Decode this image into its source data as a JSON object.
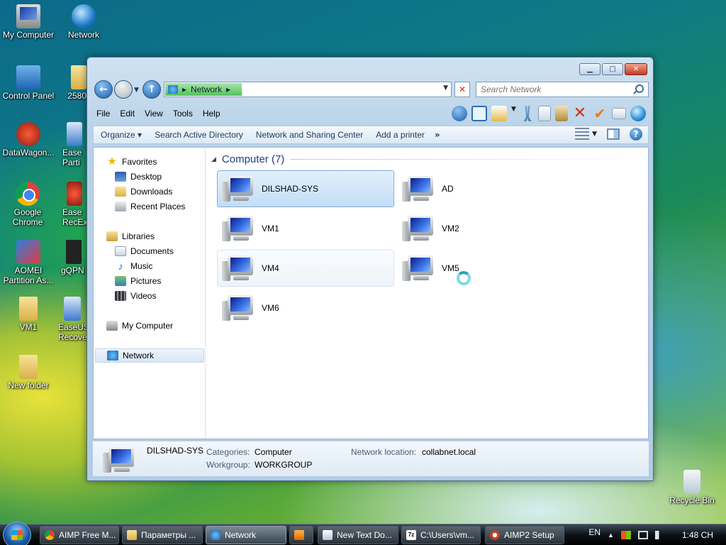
{
  "desktop_icons": [
    {
      "label": "My Computer"
    },
    {
      "label": "Network"
    },
    {
      "label": "Control Panel"
    },
    {
      "label": "2580"
    },
    {
      "label": "DataWagon..."
    },
    {
      "label": "Ease Parti"
    },
    {
      "label": "Google Chrome"
    },
    {
      "label": "Ease RecExp"
    },
    {
      "label": "AOMEI Partition As..."
    },
    {
      "label": "gQPN"
    },
    {
      "label": "VM1"
    },
    {
      "label": "EaseUS Recove"
    },
    {
      "label": "New folder"
    },
    {
      "label": "Recycle Bin"
    }
  ],
  "window": {
    "caption_buttons": {
      "minimize": "▁",
      "maximize": "□",
      "close": "✕"
    },
    "address": {
      "location": "Network",
      "crumb_sep": "▸"
    },
    "search": {
      "placeholder": "Search Network"
    },
    "menu": [
      "File",
      "Edit",
      "View",
      "Tools",
      "Help"
    ],
    "commands": {
      "organize": "Organize ▾",
      "items": [
        "Search Active Directory",
        "Network and Sharing Center",
        "Add a printer"
      ],
      "more": "»",
      "help": "?"
    },
    "nav_pane": {
      "favorites": "Favorites",
      "favorites_items": [
        "Desktop",
        "Downloads",
        "Recent Places"
      ],
      "libraries": "Libraries",
      "libraries_items": [
        "Documents",
        "Music",
        "Pictures",
        "Videos"
      ],
      "my_computer": "My Computer",
      "network": "Network"
    },
    "group_header": "Computer (7)",
    "computers": [
      "DILSHAD-SYS",
      "AD",
      "VM1",
      "VM2",
      "VM4",
      "VM5",
      "VM6"
    ],
    "details": {
      "name": "DILSHAD-SYS",
      "categories_label": "Categories:",
      "categories_value": "Computer",
      "workgroup_label": "Workgroup:",
      "workgroup_value": "WORKGROUP",
      "netloc_label": "Network location:",
      "netloc_value": "collabnet.local"
    }
  },
  "taskbar": {
    "buttons": [
      "AIMP Free M...",
      "Параметры ...",
      "Network",
      "",
      "New Text Do...",
      "C:\\Users\\vm...",
      "AIMP2 Setup"
    ],
    "lang": "EN",
    "tray_arrow": "▲",
    "clock": "1:48 CH"
  }
}
